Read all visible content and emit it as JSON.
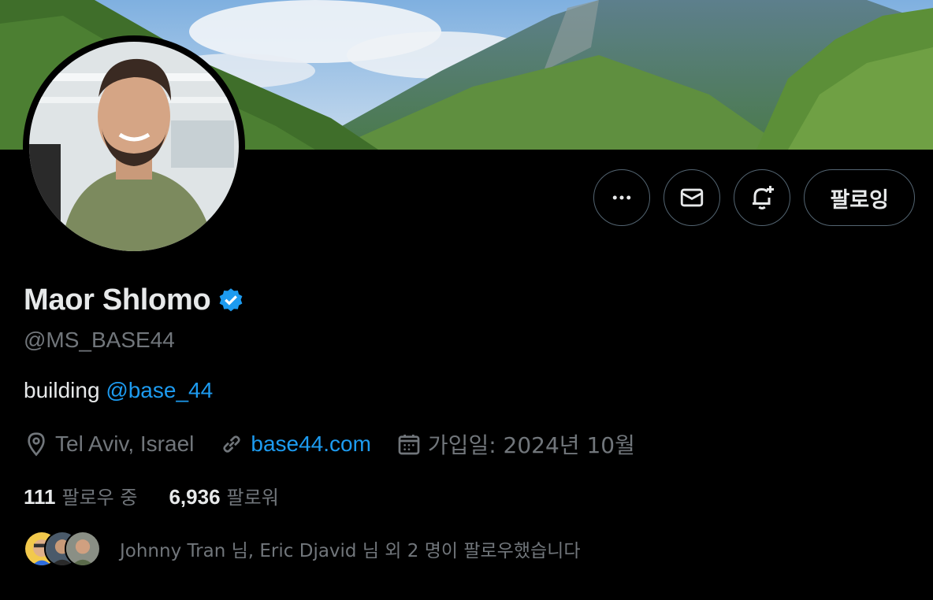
{
  "profile": {
    "name": "Maor Shlomo",
    "handle": "@MS_BASE44",
    "bio_text": "building",
    "bio_mention": "@base_44",
    "verified": true,
    "location": "Tel Aviv, Israel",
    "website": "base44.com",
    "joined": "가입일: 2024년 10월"
  },
  "actions": {
    "follow_label": "팔로잉"
  },
  "stats": {
    "following_count": "111",
    "following_label": "팔로우 중",
    "followers_count": "6,936",
    "followers_label": "팔로워"
  },
  "followed_by": {
    "text": "Johnny Tran 님, Eric Djavid 님 외 2 명이 팔로우했습니다"
  },
  "colors": {
    "accent": "#1d9bf0",
    "background": "#000000",
    "muted_text": "#71767b",
    "border": "#536471"
  },
  "icons": [
    "more-icon",
    "mail-icon",
    "notification-add-icon",
    "location-icon",
    "link-icon",
    "calendar-icon",
    "verified-badge-icon"
  ]
}
